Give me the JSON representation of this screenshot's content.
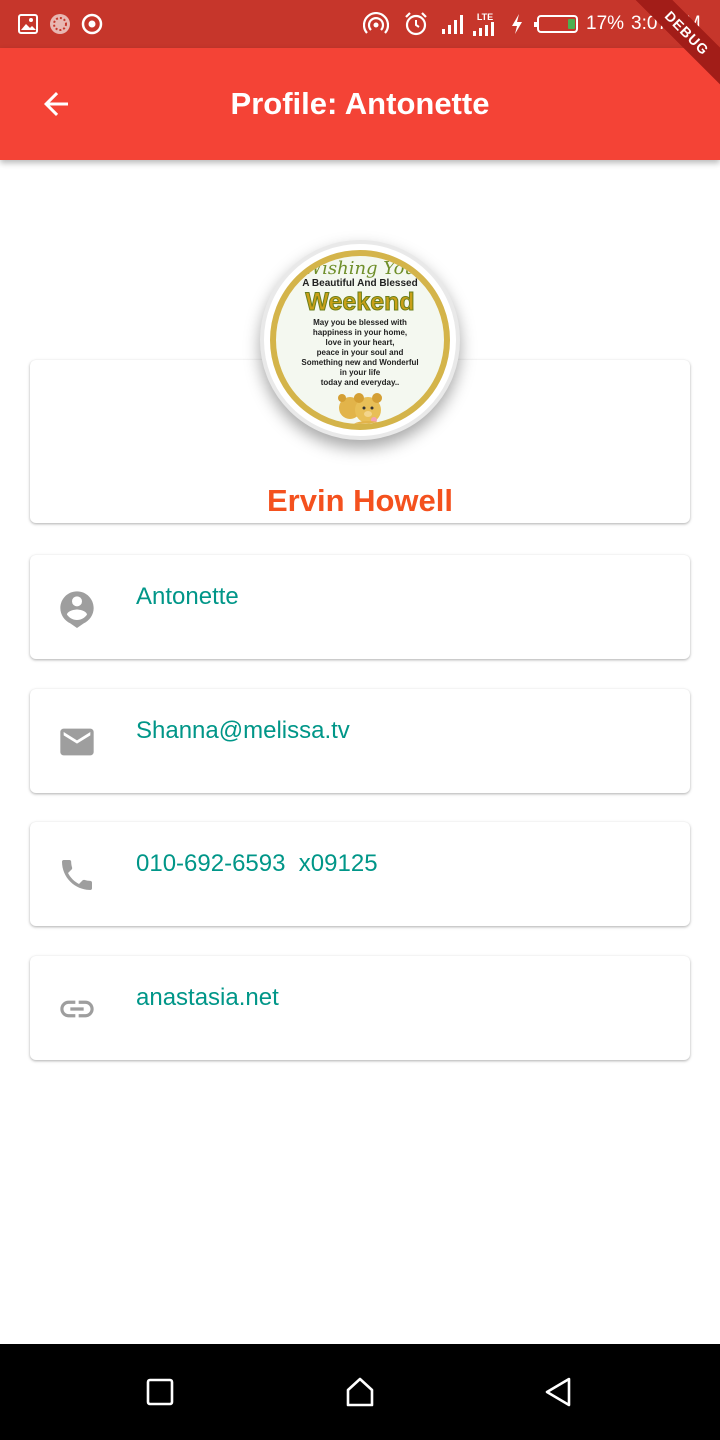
{
  "status_bar": {
    "battery_percent": "17%",
    "time": "3:07 AM",
    "network_label": "LTE",
    "icons": [
      "gallery-icon",
      "app-icon",
      "record-icon",
      "hotspot-icon",
      "alarm-icon",
      "signal-icon",
      "lte-signal-icon",
      "charging-icon",
      "battery-icon"
    ]
  },
  "debug_banner": "DEBUG",
  "app_bar": {
    "title": "Profile: Antonette",
    "back_icon": "back-arrow-icon"
  },
  "profile": {
    "name": "Ervin Howell",
    "avatar": {
      "line1": "Wishing You",
      "line2": "A Beautiful And Blessed",
      "line3": "Weekend",
      "body": [
        "May you be blessed with",
        "happiness in your home,",
        "love in your heart,",
        "peace in your soul and",
        "Something new and Wonderful",
        "in your life",
        "today and everyday.."
      ]
    }
  },
  "info": [
    {
      "icon": "account-icon",
      "text": "Antonette"
    },
    {
      "icon": "email-icon",
      "text": "Shanna@melissa.tv"
    },
    {
      "icon": "phone-icon",
      "text": "010-692-6593  x09125"
    },
    {
      "icon": "link-icon",
      "text": "anastasia.net"
    }
  ],
  "nav_bar": {
    "buttons": [
      "recents-square-icon",
      "home-icon",
      "back-triangle-icon"
    ]
  },
  "colors": {
    "status_bar": "#c6362b",
    "app_bar": "#f44336",
    "name": "#f4511e",
    "info_text": "#009688",
    "icon_grey": "#9e9e9e"
  }
}
